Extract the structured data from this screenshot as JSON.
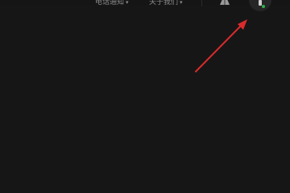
{
  "header": {
    "nav": [
      {
        "label": "电话通知"
      },
      {
        "label": "关于我们"
      }
    ]
  },
  "icons": {
    "profile": "user-profile-icon",
    "account": "account-avatar-icon",
    "caret": "caret-down-icon"
  },
  "colors": {
    "background": "#161616",
    "arrow": "#d92b2b",
    "status": "#2fae4a"
  }
}
